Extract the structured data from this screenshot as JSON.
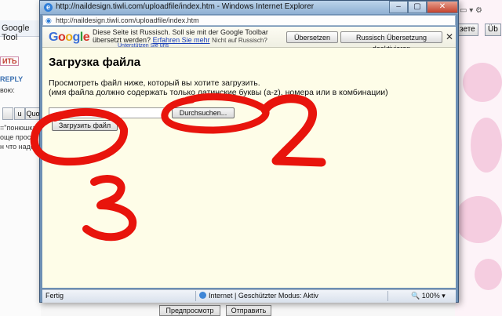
{
  "window": {
    "title": "http://naildesign.tiwli.com/uploadfile/index.htm - Windows Internet Explorer",
    "address": "http://naildesign.tiwli.com/uploadfile/index.htm",
    "controls": {
      "minimize": "–",
      "maximize": "▢",
      "close": "✕"
    }
  },
  "google_toolbar": {
    "logo_letters": [
      "G",
      "o",
      "o",
      "g",
      "l",
      "e"
    ],
    "message_line1": "Diese Seite ist Russisch. Soll sie mit der Google Toolbar",
    "message_line2_prefix": "übersetzt werden?",
    "learn_more_link": "Erfahren Sie mehr",
    "not_russian": "Nicht auf Russisch?",
    "partial_link": "Unterstützen Sie uns",
    "translate_button": "Übersetzen",
    "deactivate_button": "Russisch Übersetzung deaktivieren",
    "close_icon": "✕"
  },
  "page": {
    "heading": "Загрузка файла",
    "instruction_line1": "Просмотреть файл ниже, который вы хотите загрузить.",
    "instruction_line2": "(имя файла должно содержать только латинские буквы (a-z), номера или в комбинации)",
    "browse_button": "Durchsuchen...",
    "upload_button": "Загрузить файл"
  },
  "status_bar": {
    "text": "Fertig",
    "zone": "Internet | Geschützter Modus: Aktiv",
    "zoom": "100%"
  },
  "background": {
    "toolbar_fragment": "Google Tool",
    "word1": "ИТЬ",
    "word2": "REPLY",
    "word3": "вою:",
    "word4": "=\"понюшка",
    "word5": "още просто",
    "word6": "н что надо.",
    "small_btn1": "u",
    "small_btn2": "Quo",
    "right_btn1": "зете",
    "right_btn2": "Üb",
    "preview_button": "Предпросмотр",
    "send_button": "Отправить"
  },
  "annotations": {
    "label1": "2",
    "label2": "3"
  },
  "colors": {
    "annotation_red": "#e8140c",
    "page_background": "#fefde8",
    "google_bar": "#f5f5e8"
  }
}
